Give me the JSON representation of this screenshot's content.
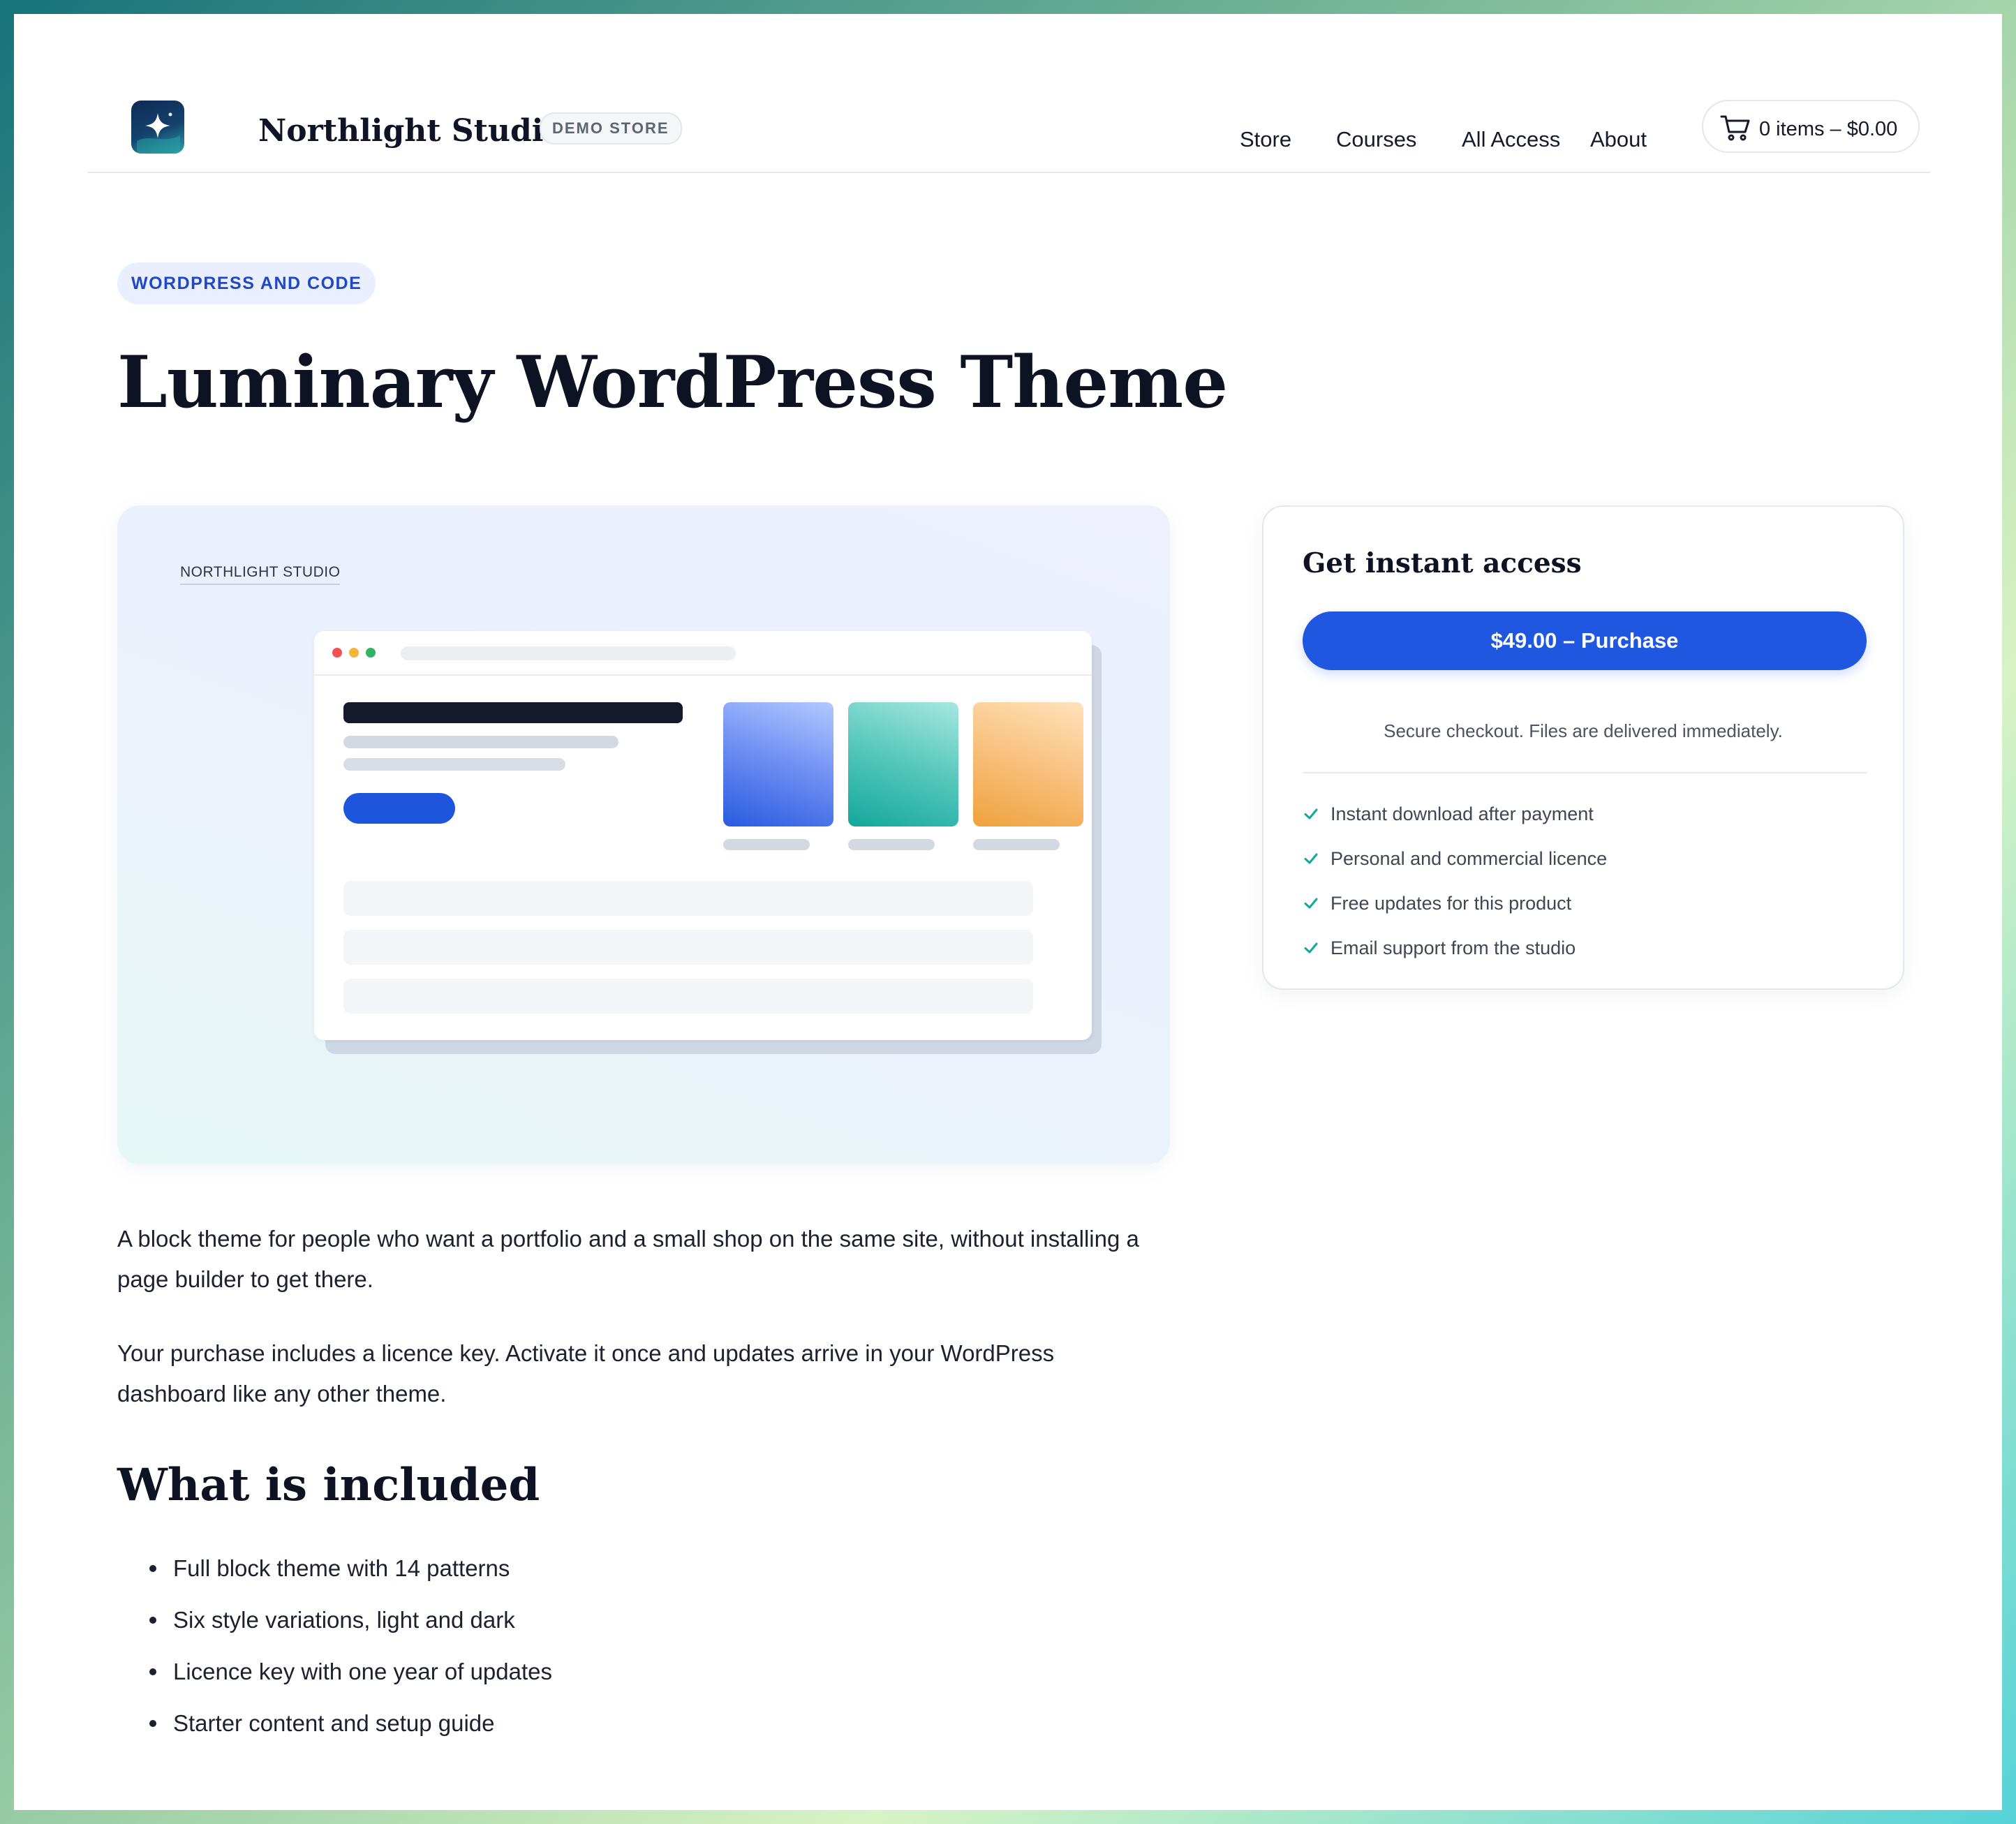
{
  "header": {
    "brand_name": "Northlight Studio",
    "badge": "DEMO STORE",
    "nav": [
      {
        "label": "Store"
      },
      {
        "label": "Courses"
      },
      {
        "label": "All Access"
      },
      {
        "label": "About"
      }
    ],
    "cart": {
      "label": "0 items – $0.00",
      "icon": "cart-icon"
    },
    "logo_icon": "sparkle-star-icon"
  },
  "product": {
    "category": "WORDPRESS AND CODE",
    "title": "Luminary WordPress Theme",
    "hero_label": "NORTHLIGHT STUDIO",
    "description": [
      "A block theme for people who want a portfolio and a small shop on the same site, without installing a page builder to get there.",
      "Your purchase includes a licence key. Activate it once and updates arrive in your WordPress dashboard like any other theme."
    ],
    "included_heading": "What is included",
    "included": [
      "Full block theme with 14 patterns",
      "Six style variations, light and dark",
      "Licence key with one year of updates",
      "Starter content and setup guide"
    ]
  },
  "purchase_card": {
    "title": "Get instant access",
    "button_label": "$49.00 – Purchase",
    "secure_note": "Secure checkout. Files are delivered immediately.",
    "features": [
      "Instant download after payment",
      "Personal and commercial licence",
      "Free updates for this product",
      "Email support from the studio"
    ],
    "feature_icon": "check-icon"
  },
  "colors": {
    "accent": "#1f57e0",
    "category_bg": "#e9efff",
    "category_text": "#1f48c4",
    "check": "#14a79c",
    "heading": "#0d1322"
  }
}
